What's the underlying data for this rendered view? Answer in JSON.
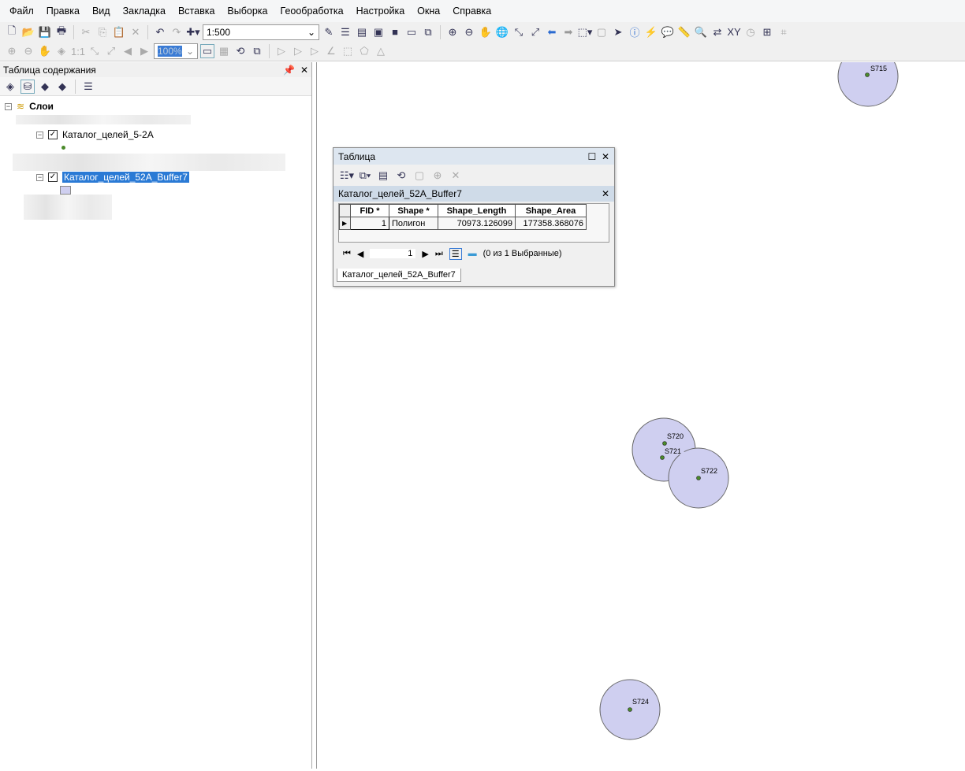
{
  "menu": [
    "Файл",
    "Правка",
    "Вид",
    "Закладка",
    "Вставка",
    "Выборка",
    "Геообработка",
    "Настройка",
    "Окна",
    "Справка"
  ],
  "toolbar": {
    "scale": "1:500",
    "zoom_pct": "100%"
  },
  "toc": {
    "title": "Таблица содержания",
    "root": "Слои",
    "layer1": "Каталог_целей_5-2А",
    "layer2": "Каталог_целей_52А_Buffer7"
  },
  "table": {
    "title": "Таблица",
    "tab": "Каталог_целей_52А_Buffer7",
    "columns": [
      "FID *",
      "Shape *",
      "Shape_Length",
      "Shape_Area"
    ],
    "rows": [
      [
        "1",
        "Полигон",
        "70973.126099",
        "177358.368076"
      ]
    ],
    "page": "1",
    "status": "(0 из 1 Выбранные)"
  },
  "map": {
    "labels": [
      "S715",
      "S720",
      "S721",
      "S722",
      "S724"
    ],
    "fill": "#cfcff0",
    "outline": "#666",
    "point": "#4a8a2a"
  }
}
